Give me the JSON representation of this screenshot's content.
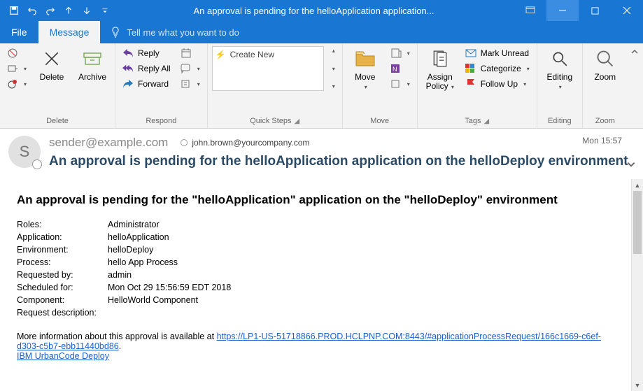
{
  "window": {
    "title": "An approval is pending for the helloApplication application..."
  },
  "tabs": {
    "file": "File",
    "message": "Message",
    "tellme": "Tell me what you want to do"
  },
  "ribbon": {
    "delete": {
      "group": "Delete",
      "ignore": "",
      "junk": "",
      "delete": "Delete",
      "archive": "Archive"
    },
    "respond": {
      "group": "Respond",
      "reply": "Reply",
      "replyall": "Reply All",
      "forward": "Forward",
      "meeting": "",
      "im": "",
      "more": ""
    },
    "quicksteps": {
      "group": "Quick Steps",
      "create": "Create New"
    },
    "move": {
      "group": "Move",
      "move": "Move",
      "rules": "",
      "onenote": "",
      "actions": ""
    },
    "tags": {
      "group": "Tags",
      "assign": "Assign Policy",
      "unread": "Mark Unread",
      "categorize": "Categorize",
      "followup": "Follow Up"
    },
    "editing": {
      "group": "Editing",
      "editing": "Editing"
    },
    "zoom": {
      "group": "Zoom",
      "zoom": "Zoom"
    }
  },
  "header": {
    "sender": "sender@example.com",
    "recipient": "john.brown@yourcompany.com",
    "timestamp": "Mon 15:57",
    "subject": "An approval is pending for the helloApplication application on the helloDeploy environment",
    "avatar_initial": "S"
  },
  "body": {
    "title": "An approval is pending for the \"helloApplication\" application on the \"helloDeploy\" environment",
    "fields": {
      "roles_k": "Roles:",
      "roles_v": "Administrator",
      "application_k": "Application:",
      "application_v": "helloApplication",
      "environment_k": "Environment:",
      "environment_v": "helloDeploy",
      "process_k": "Process:",
      "process_v": "hello App Process",
      "requestedby_k": "Requested by:",
      "requestedby_v": "admin",
      "scheduled_k": "Scheduled for:",
      "scheduled_v": "Mon Oct 29 15:56:59 EDT 2018",
      "component_k": "Component:",
      "component_v": "HelloWorld Component",
      "reqdesc_k": "Request description:",
      "reqdesc_v": ""
    },
    "more_prefix": "More information about this approval is available at ",
    "more_link": "https://LP1-US-51718866.PROD.HCLPNP.COM:8443/#applicationProcessRequest/166c1669-c6ef-d303-c5b7-ebb11440bd86",
    "more_suffix": ".",
    "product_link": "IBM UrbanCode Deploy"
  }
}
